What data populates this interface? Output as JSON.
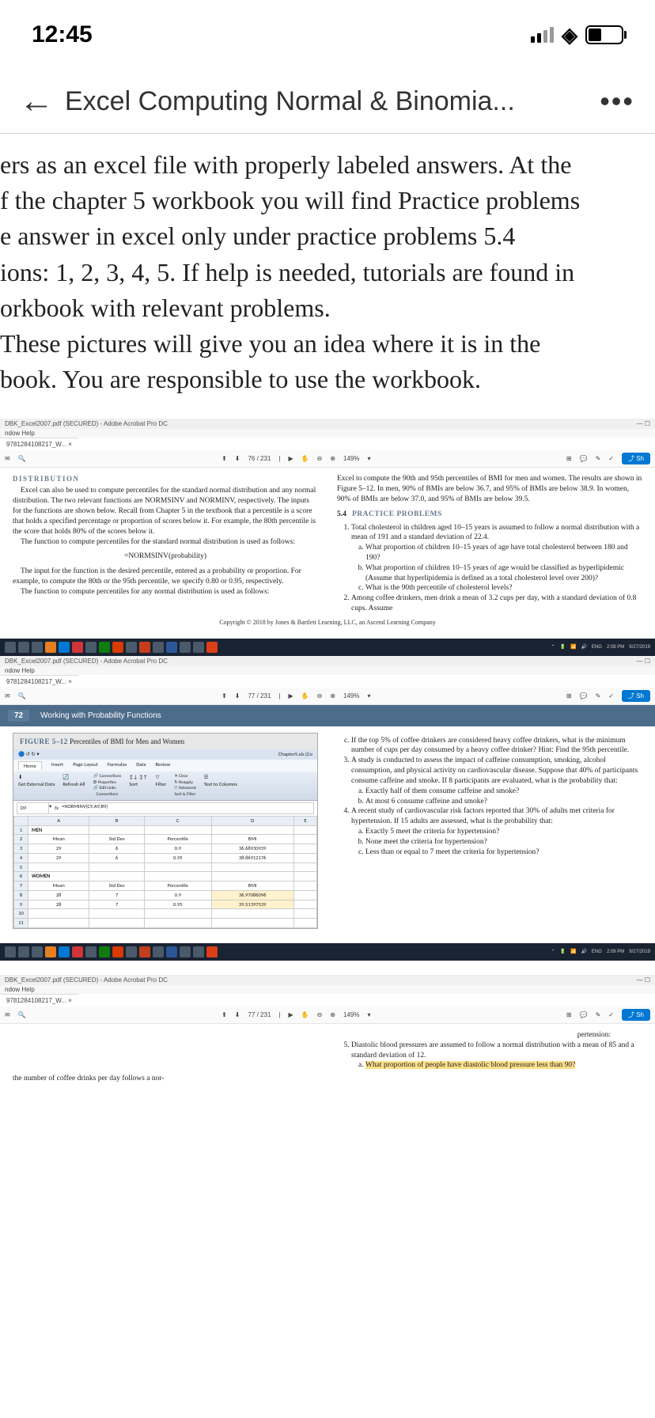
{
  "status": {
    "time": "12:45"
  },
  "header": {
    "title": "Excel Computing Normal & Binomia...",
    "back": "←",
    "menu": "•••"
  },
  "intro": {
    "line1": "ers as an excel file with properly labeled answers. At the",
    "line2": "f the chapter 5 workbook you will find Practice problems",
    "line3": "e answer in excel only under practice problems 5.4",
    "line4": "ions: 1, 2, 3, 4, 5. If help is needed, tutorials are found in",
    "line5": "orkbook with relevant problems.",
    "line6": " These pictures will give you an idea where it is in the ",
    "line7": "book. You are responsible to use the workbook."
  },
  "acrobat": {
    "title": "DBK_Excel2007.pdf (SECURED) - Adobe Acrobat Pro DC",
    "menu": "ndow  Help",
    "tab": "9781284108217_W...  ×",
    "page1": "76  / 231",
    "page2": "77  / 231",
    "zoom": "149%",
    "share": "⤴ Sh",
    "systray": {
      "lang": "ENG",
      "time1": "2:08 PM",
      "date1": "9/27/2019",
      "time2": "2:09 PM"
    }
  },
  "pdf1": {
    "dist_heading": "DISTRIBUTION",
    "left_p1": "Excel can also be used to compute percentiles for the standard normal distribution and any normal distribution. The two relevant functions are NORMSINV and NORMINV, respectively. The inputs for the functions are shown below. Recall from Chapter 5 in the textbook that a percentile is a score that holds a specified percentage or proportion of scores below it. For example, the 80th percentile is the score that holds 80% of the scores below it.",
    "left_p2": "The function to compute percentiles for the standard normal distribution is used as follows:",
    "formula1": "=NORMSINV(probability)",
    "left_p3": "The input for the function is the desired percentile, entered as a probability or proportion. For example, to compute the 80th or the 95th percentile, we specify 0.80 or 0.95, respectively.",
    "left_p4": "The function to compute percentiles for any normal distribution is used as follows:",
    "right_p1": "Excel to compute the 90th and 95th percentiles of BMI for men and women. The results are shown in Figure 5–12. In men, 90% of BMIs are below 36.7, and 95% of BMIs are below 38.9. In women, 90% of BMIs are below 37.0, and 95% of BMIs are below 39.5.",
    "prac_num": "5.4",
    "prac_title": "PRACTICE PROBLEMS",
    "q1": "Total cholesterol in children aged 10–15 years is assumed to follow a normal distribution with a mean of 191 and a standard deviation of 22.4.",
    "q1a": "What proportion of children 10–15 years of age have total cholesterol between 180 and 190?",
    "q1b": "What proportion of children 10–15 years of age would be classified as hyperlipidemic (Assume that hyperlipidemia is defined as a total cholesterol level over 200)?",
    "q1c": "What is the 90th percentile of cholesterol levels?",
    "q2": "Among coffee drinkers, men drink a mean of 3.2 cups per day, with a standard deviation of 0.8 cups. Assume",
    "copyright": "Copyright © 2018 by Jones & Bartlett Learning, LLC, an Ascend Learning Company"
  },
  "chapter": {
    "num": "72",
    "title": "Working with Probability Functions"
  },
  "figure": {
    "label": "FIGURE 5–12",
    "caption": "Percentiles of BMI for Men and Women",
    "filename": "Chapter5.xls  [Co",
    "tabs": {
      "home": "Home",
      "insert": "Insert",
      "layout": "Page Layout",
      "formulas": "Formulas",
      "data": "Data",
      "review": "Review"
    },
    "ribbon": {
      "conn": "Connections",
      "prop": "Properties",
      "editlinks": "Edit Links",
      "sort": "Sort",
      "filter": "Filter",
      "clear": "Clear",
      "reapply": "Reapply",
      "advanced": "Advanced",
      "textto": "Text to Columns",
      "refresh": "Refresh All",
      "getext": "Get External Data",
      "connections_group": "Connections",
      "sortfilter": "Sort & Filter"
    },
    "cell_ref": "D9",
    "formula": "=NORMINV(C9,A9,B9)",
    "cols": {
      "a": "A",
      "b": "B",
      "c": "C",
      "d": "D",
      "e": "E"
    },
    "row1": "MEN",
    "row2": {
      "mean": "Mean",
      "std": "Std Dev",
      "pct": "Percentile",
      "bmi": "BMI"
    },
    "row3": {
      "a": "29",
      "b": "6",
      "c": "0.9",
      "d": "36.68930939"
    },
    "row4": {
      "a": "29",
      "b": "6",
      "c": "0.95",
      "d": "38.86912176"
    },
    "row6": "WOMEN",
    "row7": {
      "mean": "Mean",
      "std": "Std Dev",
      "pct": "Percentile",
      "bmi": "BMI"
    },
    "row8": {
      "a": "28",
      "b": "7",
      "c": "0.9",
      "d": "36.97086096"
    },
    "row9": {
      "a": "28",
      "b": "7",
      "c": "0.95",
      "d": "39.51397539"
    }
  },
  "pdf2": {
    "c_text": "If the top 5% of coffee drinkers are considered heavy coffee drinkers, what is the minimum number of cups per day consumed by a heavy coffee drinker? Hint: Find the 95th percentile.",
    "q3": "A study is conducted to assess the impact of caffeine consumption, smoking, alcohol consumption, and physical activity on cardiovascular disease. Suppose that 40% of participants consume caffeine and smoke. If 8 participants are evaluated, what is the probability that:",
    "q3a": "Exactly half of them consume caffeine and smoke?",
    "q3b": "At most 6 consume caffeine and smoke?",
    "q4": "A recent study of cardiovascular risk factors reported that 30% of adults met criteria for hypertension. If 15 adults are assessed, what is the probability that:",
    "q4a": "Exactly 5 meet the criteria for hypertension?",
    "q4b": "None meet the criteria for hypertension?",
    "q4c": "Less than or equal to 7 meet the criteria for hypertension?"
  },
  "pdf3": {
    "pertension": "pertension:",
    "q5": "Diastolic blood pressures are assumed to follow a normal distribution with a mean of 85 and a standard deviation of 12.",
    "q5a": "What proportion of people have diastolic blood pressure less than 90?",
    "footer_left": "the number of coffee drinks per day follows a nor-"
  }
}
